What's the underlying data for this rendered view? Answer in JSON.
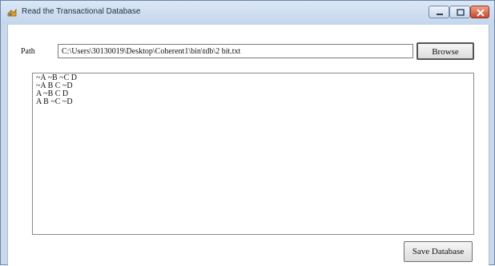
{
  "window": {
    "title": "Read the Transactional Database"
  },
  "form": {
    "path_label": "Path",
    "path_value": "C:\\Users\\30130019\\Desktop\\Coherent1\\bin\\tdb\\2 bit.txt",
    "browse_label": "Browse",
    "save_label": "Save Database",
    "data_lines": [
      "~A ~B ~C D",
      "~A B C ~D",
      "A ~B C D",
      "A B ~C ~D"
    ]
  }
}
